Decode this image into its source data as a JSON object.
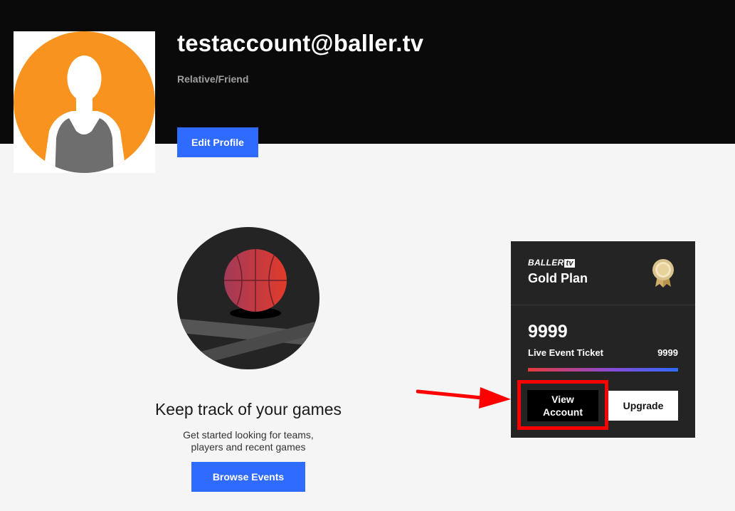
{
  "profile": {
    "email": "testaccount@baller.tv",
    "role": "Relative/Friend",
    "edit_label": "Edit Profile",
    "avatar_icon": "user-silhouette-icon"
  },
  "empty_state": {
    "title": "Keep track of your games",
    "description_line1": "Get started looking for teams,",
    "description_line2": "players and recent games",
    "button_label": "Browse Events",
    "illustration_icon": "basketball-court-icon"
  },
  "plan": {
    "brand_word": "BALLER",
    "brand_tv": "tv",
    "name": "Gold Plan",
    "medal_icon": "gold-medal-icon",
    "balance": "9999",
    "ticket_label": "Live Event Ticket",
    "ticket_count": "9999",
    "progress_fraction": 1.0,
    "view_account_line1": "View",
    "view_account_line2": "Account",
    "upgrade_label": "Upgrade"
  },
  "colors": {
    "accent_blue": "#2f6bff",
    "avatar_orange": "#f7931e",
    "annotation_red": "#ff0000"
  }
}
